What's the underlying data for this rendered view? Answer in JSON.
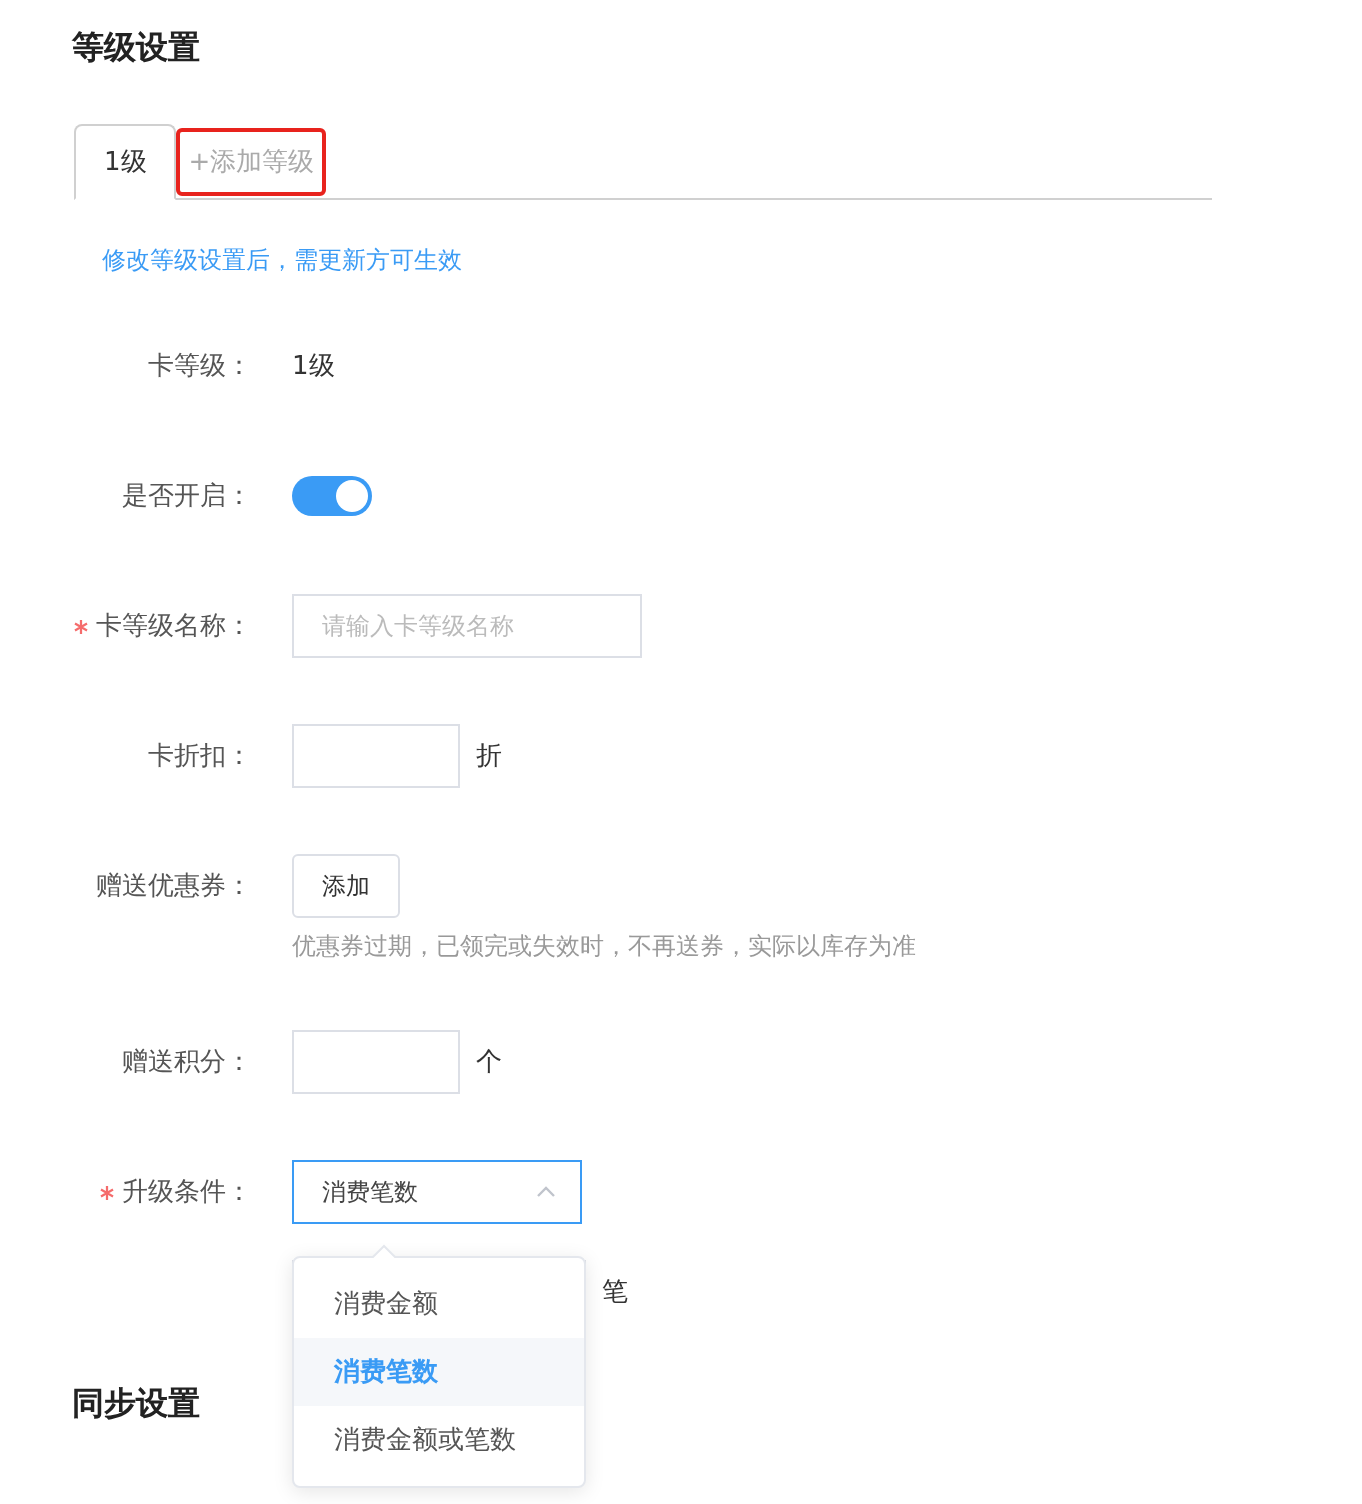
{
  "section_title": "等级设置",
  "tabs": [
    {
      "label": "1级",
      "selected": true,
      "highlighted": false
    },
    {
      "label": "+添加等级",
      "selected": false,
      "highlighted": true
    }
  ],
  "notice": "修改等级设置后，需更新方可生效",
  "form": [
    {
      "kind": "text",
      "label": "卡等级：",
      "required": false,
      "value": "1级"
    },
    {
      "kind": "switch",
      "label": "是否开启：",
      "required": false,
      "on": true
    },
    {
      "kind": "input",
      "label": "卡等级名称：",
      "required": true,
      "placeholder": "请输入卡等级名称"
    },
    {
      "kind": "input",
      "label": "卡折扣：",
      "required": false,
      "unit": "折"
    },
    {
      "kind": "button",
      "label": "赠送优惠券：",
      "required": false,
      "button": "添加",
      "hint": "优惠券过期，已领完或失效时，不再送券，实际以库存为准"
    },
    {
      "kind": "input",
      "label": "赠送积分：",
      "required": false,
      "unit": "个"
    },
    {
      "kind": "select",
      "label": "升级条件：",
      "required": true,
      "value": "消费笔数",
      "expanded": true,
      "options": [
        {
          "label": "消费金额",
          "selected": false
        },
        {
          "label": "消费笔数",
          "selected": true
        },
        {
          "label": "消费金额或笔数",
          "selected": false
        }
      ]
    },
    {
      "kind": "input",
      "required": false,
      "unit": "笔",
      "tight": true
    }
  ],
  "sync_title": "同步设置"
}
